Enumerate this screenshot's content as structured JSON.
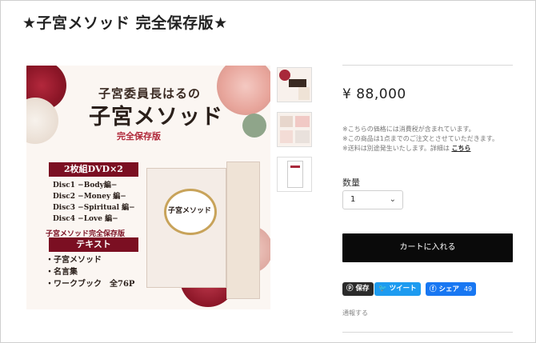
{
  "page": {
    "title": "★子宮メソッド 完全保存版★"
  },
  "main_image": {
    "heading_small": "子宮委員長はるの",
    "heading_large": "子宮メソッド",
    "heading_edition": "完全保存版",
    "dvd_badge": "2枚組DVD×2",
    "discs": [
      "Disc1 −Body編−",
      "Disc2 −Money 編−",
      "Disc3 −Spiritual 編−",
      "Disc4 −Love 編−"
    ],
    "text_caption": "子宮メソッド完全保存版",
    "text_badge": "テキスト",
    "texts": [
      "・子宮メソッド",
      "・名言集",
      "・ワークブック　全76P"
    ],
    "box_title": "子宮メソッド"
  },
  "product": {
    "price": "¥ 88,000",
    "notes": [
      "※こちらの価格には消費税が含まれています。",
      "※この商品は1点までのご注文とさせていただきます。",
      "※送料は別途発生いたします。詳細は"
    ],
    "notes_link": "こちら",
    "quantity_label": "数量",
    "quantity_value": "1",
    "cart_button": "カートに入れる"
  },
  "share": {
    "save_label": "保存",
    "tweet_label": "ツイート",
    "fb_label": "シェア",
    "fb_count": "49",
    "report_label": "通報する"
  },
  "colors": {
    "accent": "#7b0f22",
    "cart_button": "#0a0a0a",
    "twitter": "#1d9bf0",
    "facebook": "#1877f2"
  },
  "icons": [
    "pinterest-icon",
    "twitter-bird-icon",
    "facebook-icon",
    "chevron-down-icon"
  ]
}
